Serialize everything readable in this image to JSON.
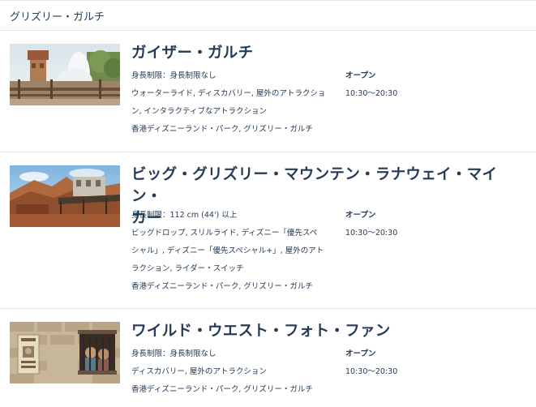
{
  "section": {
    "title": "グリズリー・ガルチ"
  },
  "attractions": [
    {
      "name": "ガイザー・ガルチ",
      "height_requirement": "身長制限：身長制限なし",
      "categories_line1": "ウォーターライド, ディスカバリー, 屋外のアトラクショ",
      "categories_line2": "ン, インタラクティブなアトラクション",
      "location": "香港ディズニーランド・パーク, グリズリー・ガルチ",
      "status": "オープン",
      "hours": "10:30～20:30"
    },
    {
      "name_line1": "ビッグ・グリズリー・マウンテン・ラナウェイ・マイン・",
      "name_line2": "カー",
      "height_requirement": "身長制限：112 cm (44') 以上",
      "categories_line1": "ビッグドロップ, スリルライド, ディズニー「優先スペ",
      "categories_line2": "シャル」, ディズニー「優先スペシャル+」, 屋外のアト",
      "categories_line3": "ラクション, ライダー・スイッチ",
      "location": "香港ディズニーランド・パーク, グリズリー・ガルチ",
      "status": "オープン",
      "hours": "10:30～20:30"
    },
    {
      "name": "ワイルド・ウエスト・フォト・ファン",
      "height_requirement": "身長制限：身長制限なし",
      "categories_line1": "ディスカバリー, 屋外のアトラクション",
      "location": "香港ディズニーランド・パーク, グリズリー・ガルチ",
      "status": "オープン",
      "hours": "10:30～20:30"
    }
  ]
}
